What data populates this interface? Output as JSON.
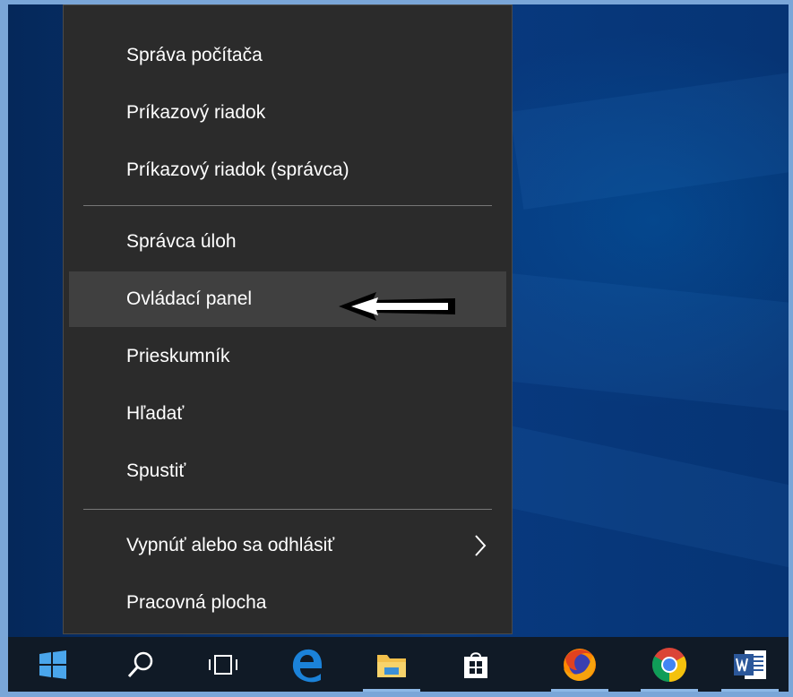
{
  "menu": {
    "items": [
      {
        "label": "Správa počítača"
      },
      {
        "label": "Príkazový riadok"
      },
      {
        "label": "Príkazový riadok (správca)"
      },
      {
        "label": "Správca úloh"
      },
      {
        "label": "Ovládací panel"
      },
      {
        "label": "Prieskumník"
      },
      {
        "label": "Hľadať"
      },
      {
        "label": "Spustiť"
      },
      {
        "label": "Vypnúť alebo sa odhlásiť"
      },
      {
        "label": "Pracovná plocha"
      }
    ],
    "highlighted_item": "Ovládací panel",
    "submenu_icon": "chevron-right-icon",
    "annotation_icon": "left-arrow-annotation-icon"
  },
  "taskbar": {
    "buttons": [
      {
        "icon": "windows-start-icon"
      },
      {
        "icon": "search-icon"
      },
      {
        "icon": "task-view-icon"
      },
      {
        "icon": "edge-browser-icon"
      },
      {
        "icon": "file-explorer-icon"
      },
      {
        "icon": "store-icon"
      },
      {
        "icon": "firefox-icon"
      },
      {
        "icon": "chrome-icon"
      },
      {
        "icon": "word-icon"
      }
    ],
    "accent": "#8db8e6",
    "background": "#101a26"
  },
  "colors": {
    "menu_background": "#2b2b2b",
    "menu_highlight": "#404040",
    "menu_text": "#ffffff",
    "desktop": "#083a80",
    "frame_border": "#7aa6d8"
  }
}
